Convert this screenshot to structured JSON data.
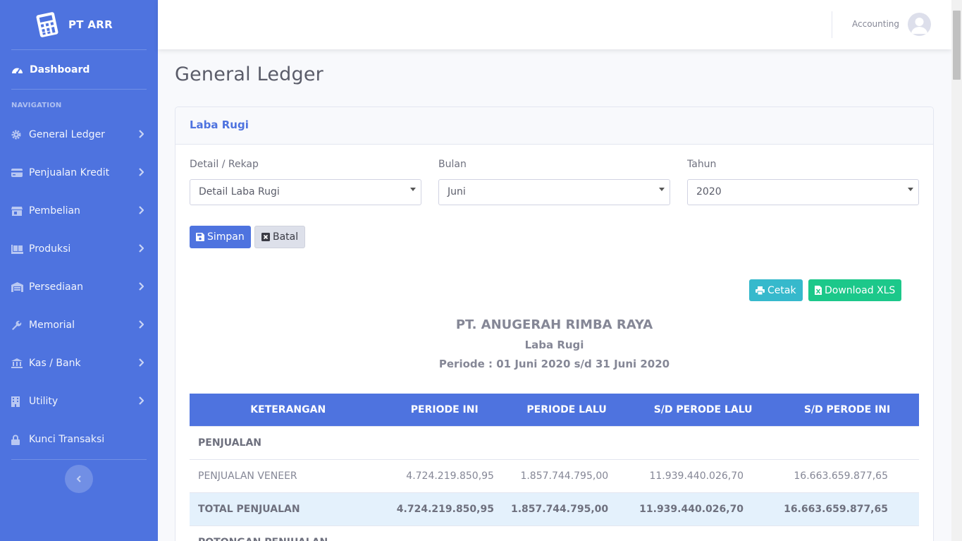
{
  "brand": {
    "name": "PT ARR",
    "icon": "calculator-icon"
  },
  "sidebar": {
    "dashboard_label": "Dashboard",
    "heading": "NAVIGATION",
    "items": [
      {
        "label": "General Ledger",
        "icon": "cog-icon"
      },
      {
        "label": "Penjualan Kredit",
        "icon": "credit-card-icon"
      },
      {
        "label": "Pembelian",
        "icon": "store-icon"
      },
      {
        "label": "Produksi",
        "icon": "pallet-icon"
      },
      {
        "label": "Persediaan",
        "icon": "warehouse-icon"
      },
      {
        "label": "Memorial",
        "icon": "wrench-icon"
      },
      {
        "label": "Kas / Bank",
        "icon": "bank-icon"
      },
      {
        "label": "Utility",
        "icon": "building-icon"
      },
      {
        "label": "Kunci Transaksi",
        "icon": "lock-icon"
      }
    ]
  },
  "topbar": {
    "user_name": "Accounting"
  },
  "page": {
    "title": "General Ledger"
  },
  "card": {
    "title": "Laba Rugi"
  },
  "form": {
    "detail_label": "Detail / Rekap",
    "detail_value": "Detail Laba Rugi",
    "bulan_label": "Bulan",
    "bulan_value": "Juni",
    "tahun_label": "Tahun",
    "tahun_value": "2020",
    "save_label": "Simpan",
    "cancel_label": "Batal"
  },
  "actions": {
    "print_label": "Cetak",
    "download_label": "Download XLS"
  },
  "report": {
    "company": "PT. ANUGERAH RIMBA RAYA",
    "title": "Laba Rugi",
    "period": "Periode : 01 Juni 2020 s/d 31 Juni 2020",
    "columns": [
      "KETERANGAN",
      "PERIODE INI",
      "PERIODE LALU",
      "S/D PERODE LALU",
      "S/D PERODE INI"
    ],
    "rows": [
      {
        "cells": [
          "PENJUALAN",
          "",
          "",
          "",
          ""
        ]
      },
      {
        "cells": [
          "PENJUALAN VENEER",
          "4.724.219.850,95",
          "1.857.744.795,00",
          "11.939.440.026,70",
          "16.663.659.877,65"
        ]
      },
      {
        "cells": [
          "TOTAL PENJUALAN",
          "4.724.219.850,95",
          "1.857.744.795,00",
          "11.939.440.026,70",
          "16.663.659.877,65"
        ]
      },
      {
        "cells": [
          "POTONGAN PENJUALAN",
          "",
          "",
          "",
          ""
        ]
      }
    ]
  },
  "colors": {
    "primary": "#4e73df",
    "info": "#36b9cc",
    "success": "#1cc88a",
    "total_row": "#e4f1fc"
  }
}
